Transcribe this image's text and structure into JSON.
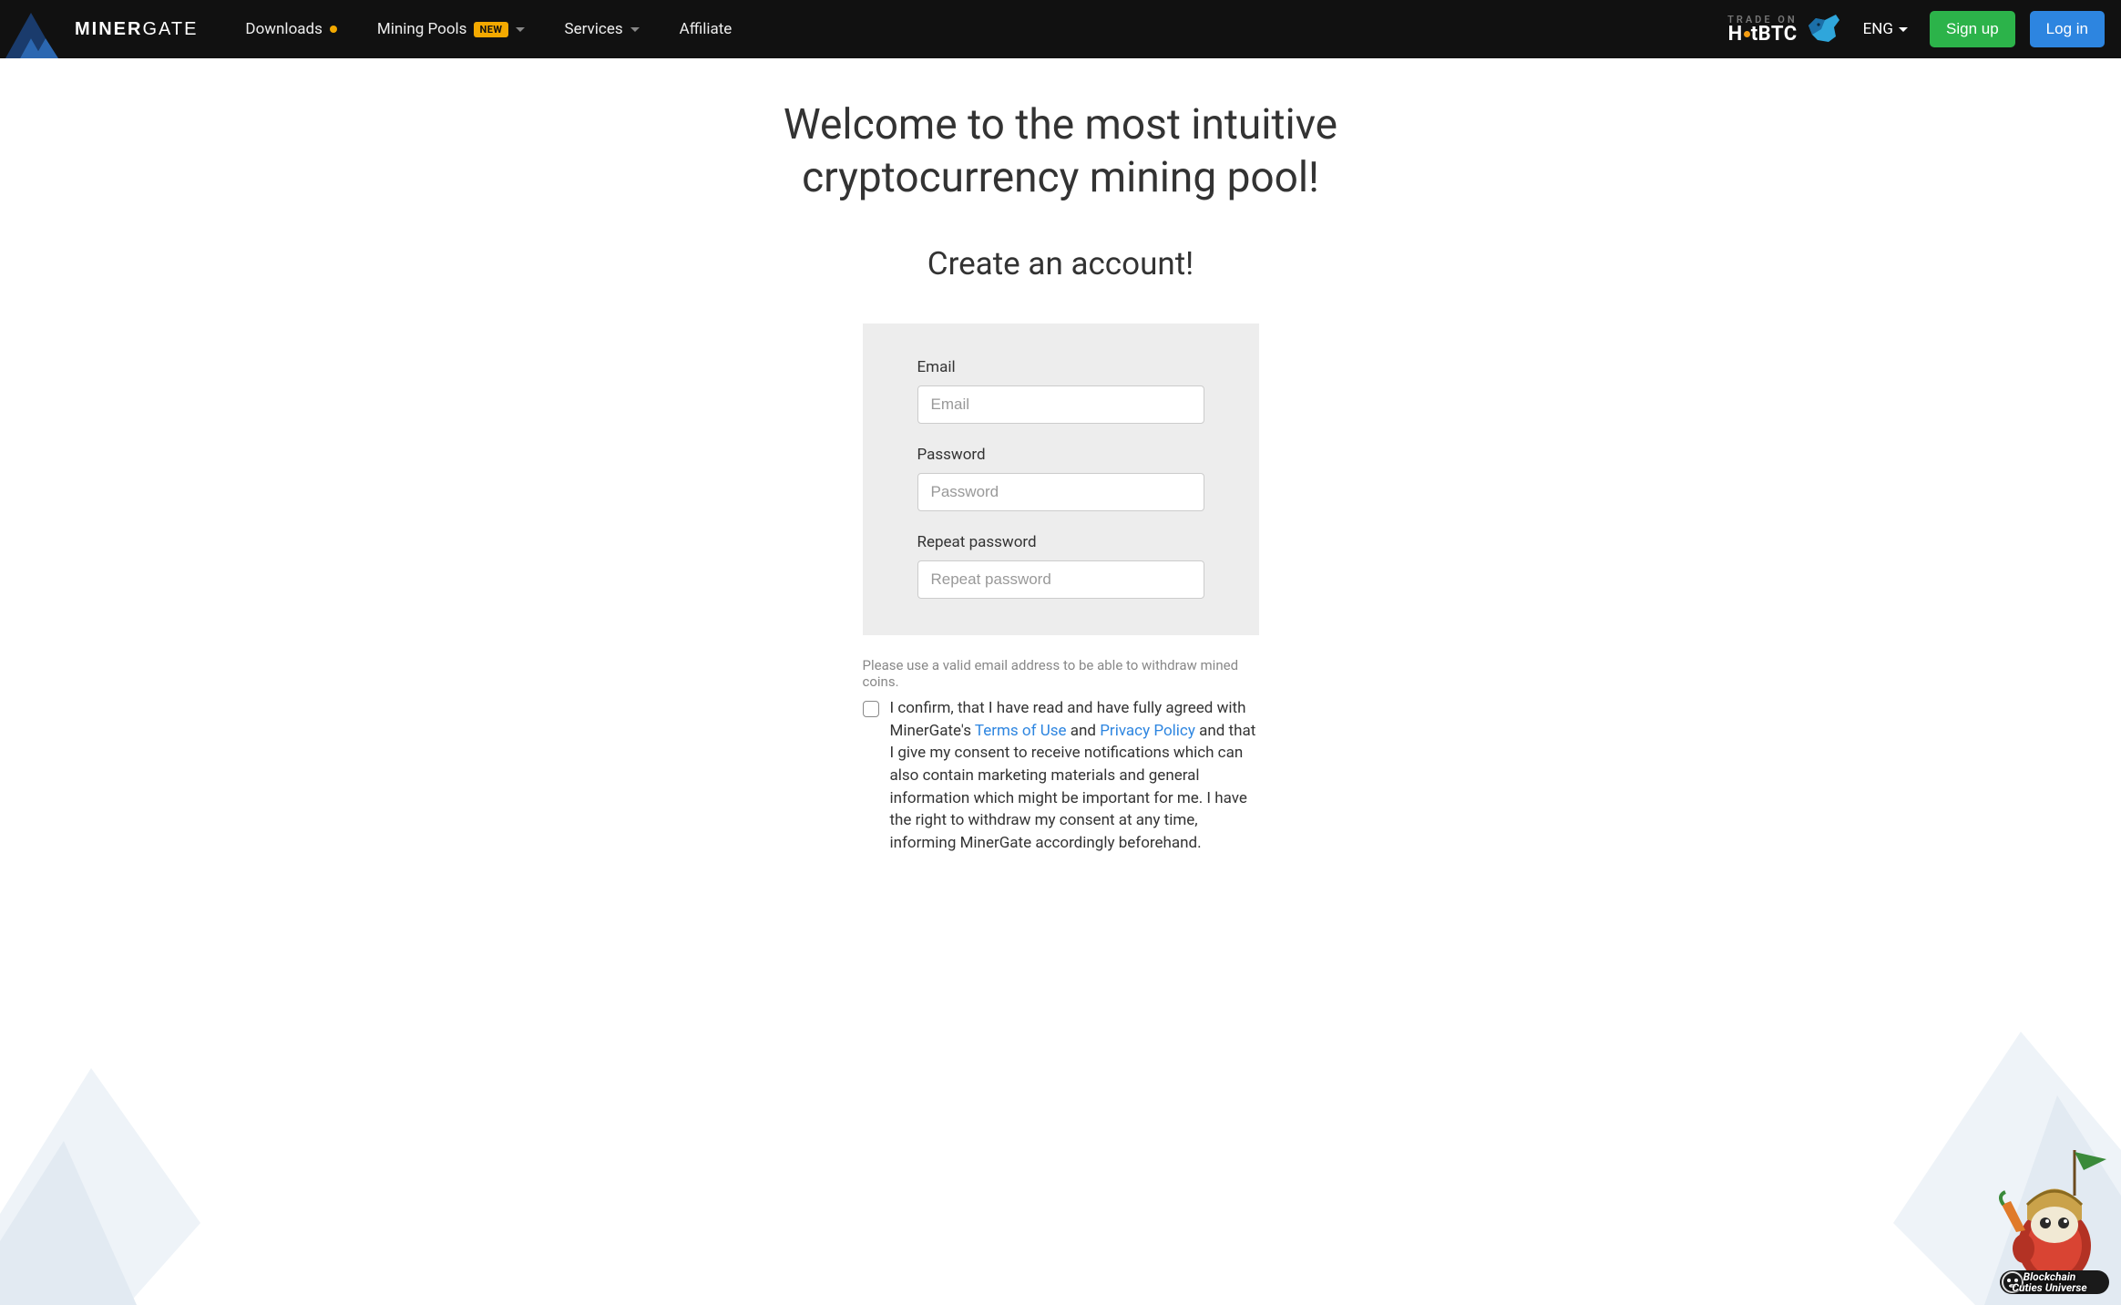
{
  "brand": {
    "name1": "Miner",
    "name2": "Gate"
  },
  "nav": {
    "downloads": "Downloads",
    "mining_pools": "Mining Pools",
    "new_badge": "NEW",
    "services": "Services",
    "affiliate": "Affiliate"
  },
  "trade": {
    "top": "TRADE ON",
    "brand_left": "H",
    "brand_right": "tBTC"
  },
  "lang": "ENG",
  "buttons": {
    "signup": "Sign up",
    "login": "Log in"
  },
  "title": "Welcome to the most intuitive cryptocurrency mining pool!",
  "subtitle": "Create an account!",
  "form": {
    "email_label": "Email",
    "email_placeholder": "Email",
    "password_label": "Password",
    "password_placeholder": "Password",
    "repeat_label": "Repeat password",
    "repeat_placeholder": "Repeat password"
  },
  "disclaimer": "Please use a valid email address to be able to withdraw mined coins.",
  "consent": {
    "p1": "I confirm, that I have read and have fully agreed with MinerGate's ",
    "terms": "Terms of Use",
    "and": " and ",
    "privacy": "Privacy Policy",
    "p2": " and that I give my consent to receive notifications which can also contain marketing materials and general information which might be important for me. I have the right to withdraw my consent at any time, informing MinerGate accordingly beforehand."
  },
  "cuties": {
    "line1": "Blockchain",
    "line2": "Cuties Universe"
  }
}
